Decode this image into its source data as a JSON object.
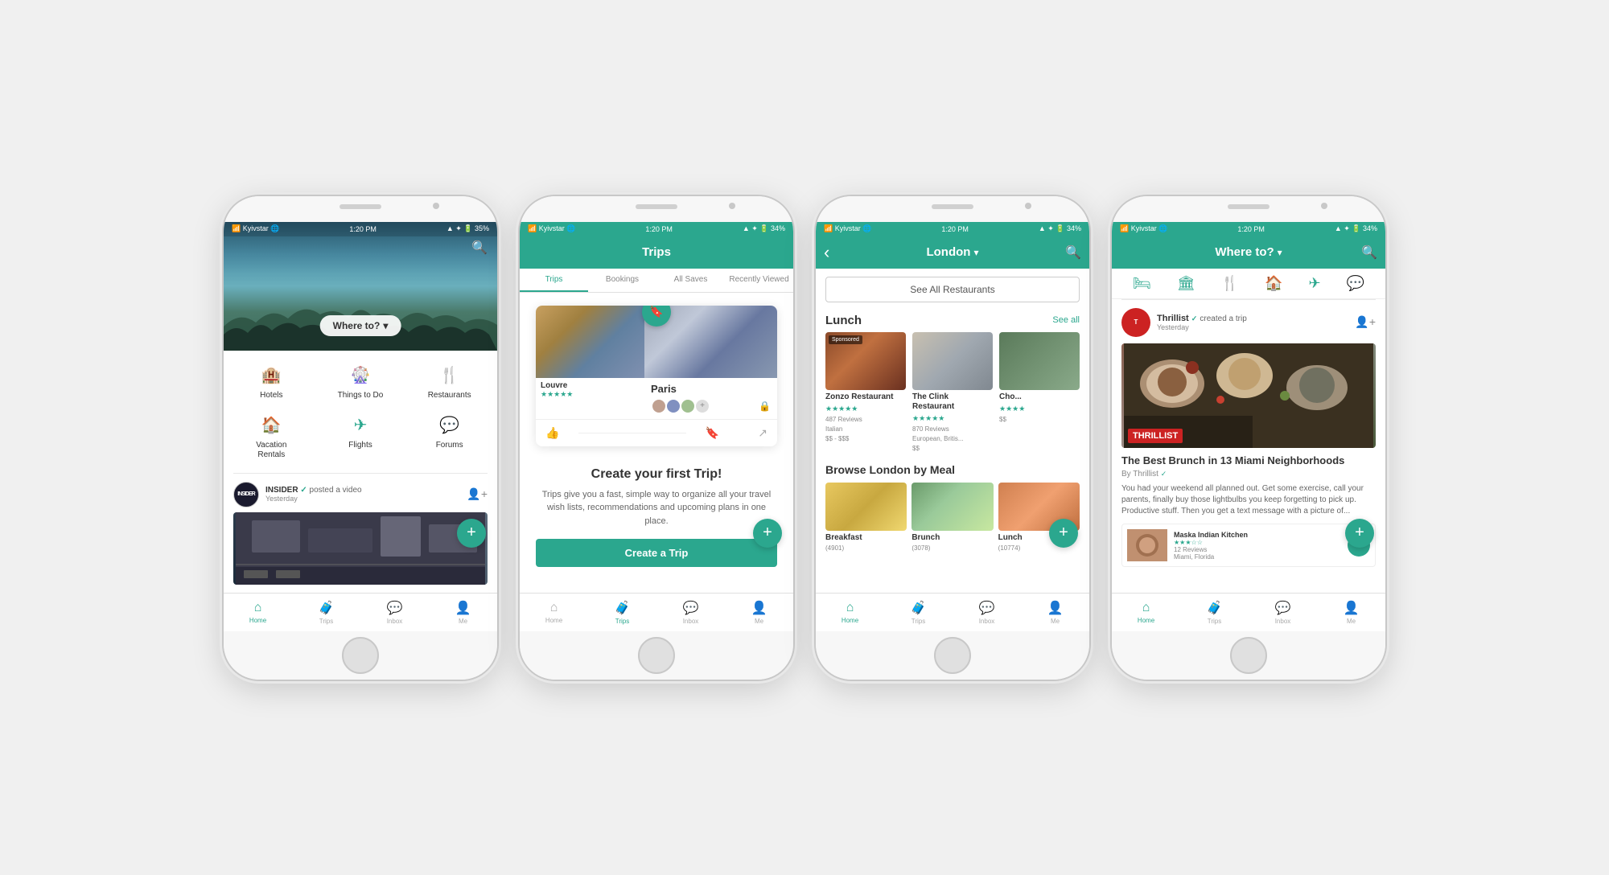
{
  "phones": [
    {
      "id": "phone1",
      "statusBar": {
        "carrier": "Kyivstar",
        "time": "1:20 PM",
        "battery": "35%",
        "icons": "▲ ✦"
      },
      "header": {
        "searchIcon": "🔍",
        "whereToLabel": "Where to?",
        "dropdownIcon": "▾"
      },
      "categories": [
        {
          "icon": "🏨",
          "label": "Hotels"
        },
        {
          "icon": "🎡",
          "label": "Things to Do"
        },
        {
          "icon": "🍴",
          "label": "Restaurants"
        },
        {
          "icon": "🏠",
          "label": "Vacation\nRentals"
        },
        {
          "icon": "✈",
          "label": "Flights"
        },
        {
          "icon": "💬",
          "label": "Forums"
        }
      ],
      "feed": {
        "user": "INSIDER",
        "badge": "✓",
        "action": "posted a video",
        "time": "Yesterday"
      },
      "tabBar": [
        {
          "icon": "🏠",
          "label": "Home",
          "active": true
        },
        {
          "icon": "🧳",
          "label": "Trips",
          "active": false
        },
        {
          "icon": "💬",
          "label": "Inbox",
          "active": false
        },
        {
          "icon": "👤",
          "label": "Me",
          "active": false
        }
      ]
    },
    {
      "id": "phone2",
      "statusBar": {
        "carrier": "Kyivstar",
        "time": "1:20 PM",
        "battery": "34%"
      },
      "header": {
        "title": "Trips"
      },
      "tabs": [
        {
          "label": "Trips",
          "active": true
        },
        {
          "label": "Bookings",
          "active": false
        },
        {
          "label": "All Saves",
          "active": false
        },
        {
          "label": "Recently Viewed",
          "active": false
        }
      ],
      "tripCard": {
        "title": "Paris",
        "imageAlt": "Louvre museum and Eiffel Tower",
        "stars": "★★★★★",
        "locationLabel": "Louvre"
      },
      "createTrip": {
        "title": "Create your first Trip!",
        "description": "Trips give you a fast, simple way to organize all your travel wish lists, recommendations and upcoming plans in one place.",
        "buttonLabel": "Create a Trip"
      },
      "tabBar": [
        {
          "icon": "🏠",
          "label": "Home",
          "active": false
        },
        {
          "icon": "🧳",
          "label": "Trips",
          "active": true
        },
        {
          "icon": "💬",
          "label": "Inbox",
          "active": false
        },
        {
          "icon": "👤",
          "label": "Me",
          "active": false
        }
      ]
    },
    {
      "id": "phone3",
      "statusBar": {
        "carrier": "Kyivstar",
        "time": "1:20 PM",
        "battery": "34%"
      },
      "header": {
        "backIcon": "‹",
        "location": "London",
        "dropdownIcon": "▾",
        "searchIcon": "🔍"
      },
      "seeAllBtn": "See All Restaurants",
      "lunchSection": {
        "title": "Lunch",
        "seeAll": "See all",
        "restaurants": [
          {
            "name": "Zonzo Restaurant",
            "stars": "★★★★★",
            "reviews": "487 Reviews",
            "type": "Italian",
            "price": "$$ - $$$",
            "sponsored": true,
            "imgClass": "img-pizza"
          },
          {
            "name": "The Clink Restaurant",
            "stars": "★★★★★",
            "reviews": "870 Reviews",
            "type": "European, Britis...",
            "price": "$$",
            "sponsored": false,
            "imgClass": "img-formal"
          },
          {
            "name": "Cho...",
            "stars": "★★★★",
            "reviews": "",
            "type": "",
            "price": "$$",
            "sponsored": false,
            "imgClass": "img-third"
          }
        ]
      },
      "browseSection": {
        "title": "Browse London by Meal",
        "items": [
          {
            "label": "Breakfast",
            "count": "(4901)",
            "imgClass": "img-breakfast"
          },
          {
            "label": "Brunch",
            "count": "(3078)",
            "imgClass": "img-brunch"
          },
          {
            "label": "Lunch",
            "count": "(10774)",
            "imgClass": "img-lunch"
          }
        ]
      },
      "tabBar": [
        {
          "icon": "🏠",
          "label": "Home",
          "active": true
        },
        {
          "icon": "🧳",
          "label": "Trips",
          "active": false
        },
        {
          "icon": "💬",
          "label": "Inbox",
          "active": false
        },
        {
          "icon": "👤",
          "label": "Me",
          "active": false
        }
      ]
    },
    {
      "id": "phone4",
      "statusBar": {
        "carrier": "Kyivstar",
        "time": "1:20 PM",
        "battery": "34%"
      },
      "header": {
        "whereToLabel": "Where to?",
        "dropdownIcon": "▾",
        "searchIcon": "🔍"
      },
      "newsIcons": [
        {
          "sym": "🛏",
          "name": "hotels-icon"
        },
        {
          "sym": "🏛",
          "name": "attractions-icon"
        },
        {
          "sym": "🍴",
          "name": "restaurants-icon"
        },
        {
          "sym": "🏠",
          "name": "vacation-rentals-icon"
        },
        {
          "sym": "✈",
          "name": "flights-icon"
        },
        {
          "sym": "💬",
          "name": "forums-icon"
        }
      ],
      "feedItem": {
        "user": "Thrillist",
        "badge": "✓",
        "action": "created a trip",
        "time": "Yesterday",
        "articleTitle": "The Best Brunch in 13 Miami Neighborhoods",
        "by": "By Thrillist",
        "excerpt": "You had your weekend all planned out. Get some exercise, call your parents, finally buy those lightbulbs you keep forgetting to pick up. Productive stuff. Then you get a text message with a picture of...",
        "miniCard": {
          "name": "Maska Indian Kitchen",
          "stars": "★★★☆☆",
          "reviews": "12 Reviews",
          "location": "Miami, Florida"
        }
      },
      "tabBar": [
        {
          "icon": "🏠",
          "label": "Home",
          "active": true
        },
        {
          "icon": "🧳",
          "label": "Trips",
          "active": false
        },
        {
          "icon": "💬",
          "label": "Inbox",
          "active": false
        },
        {
          "icon": "👤",
          "label": "Me",
          "active": false
        }
      ]
    }
  ]
}
